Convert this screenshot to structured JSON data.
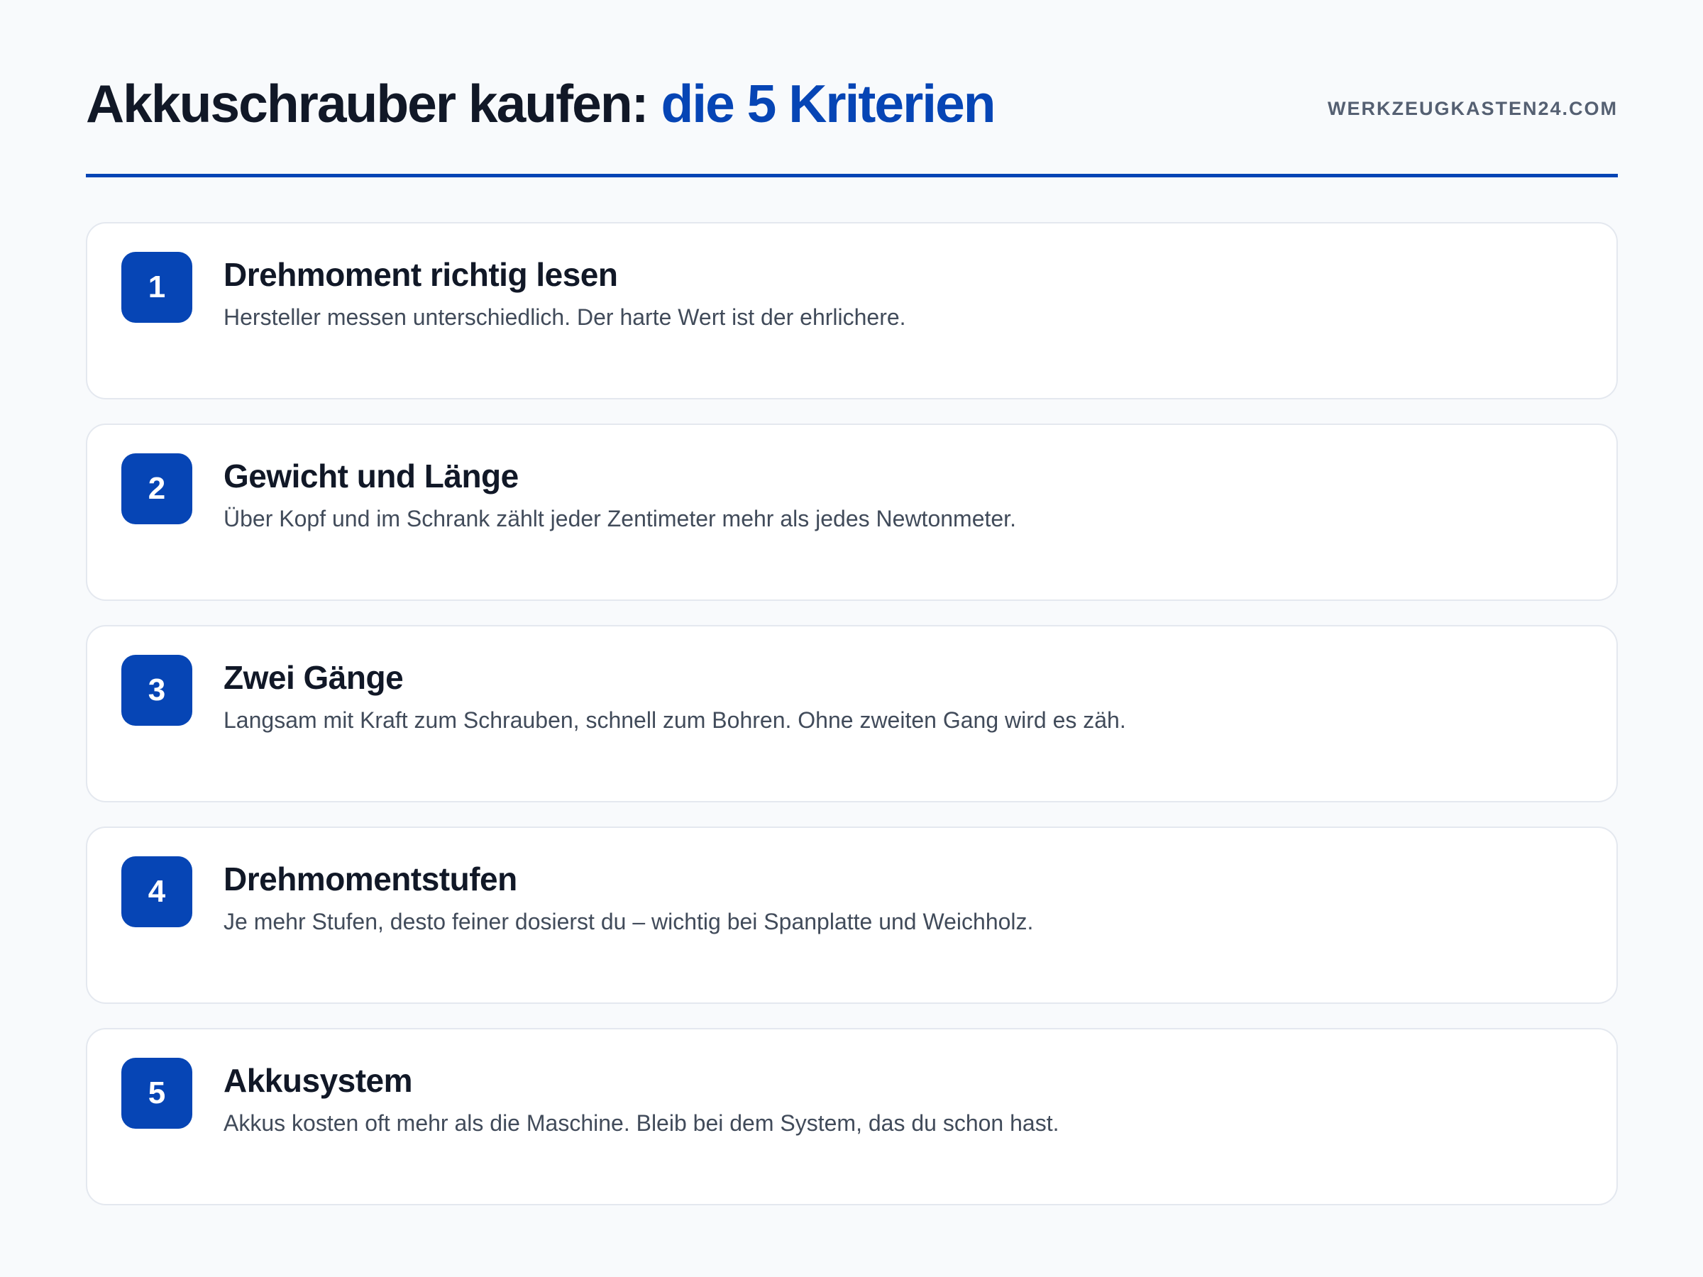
{
  "header": {
    "title_main": "Akkuschrauber kaufen:",
    "title_accent": "die 5 Kriterien",
    "site": "WERKZEUGKASTEN24.COM"
  },
  "colors": {
    "accent": "#0645b5",
    "background": "#f8fafc",
    "card": "#ffffff",
    "text": "#111827",
    "muted": "#414b5a"
  },
  "criteria": [
    {
      "number": "1",
      "title": "Drehmoment richtig lesen",
      "text": "Hersteller messen unterschiedlich. Der harte Wert ist der ehrlichere."
    },
    {
      "number": "2",
      "title": "Gewicht und Länge",
      "text": "Über Kopf und im Schrank zählt jeder Zentimeter mehr als jedes Newtonmeter."
    },
    {
      "number": "3",
      "title": "Zwei Gänge",
      "text": "Langsam mit Kraft zum Schrauben, schnell zum Bohren. Ohne zweiten Gang wird es zäh."
    },
    {
      "number": "4",
      "title": "Drehmomentstufen",
      "text": "Je mehr Stufen, desto feiner dosierst du – wichtig bei Spanplatte und Weichholz."
    },
    {
      "number": "5",
      "title": "Akkusystem",
      "text": "Akkus kosten oft mehr als die Maschine. Bleib bei dem System, das du schon hast."
    }
  ]
}
